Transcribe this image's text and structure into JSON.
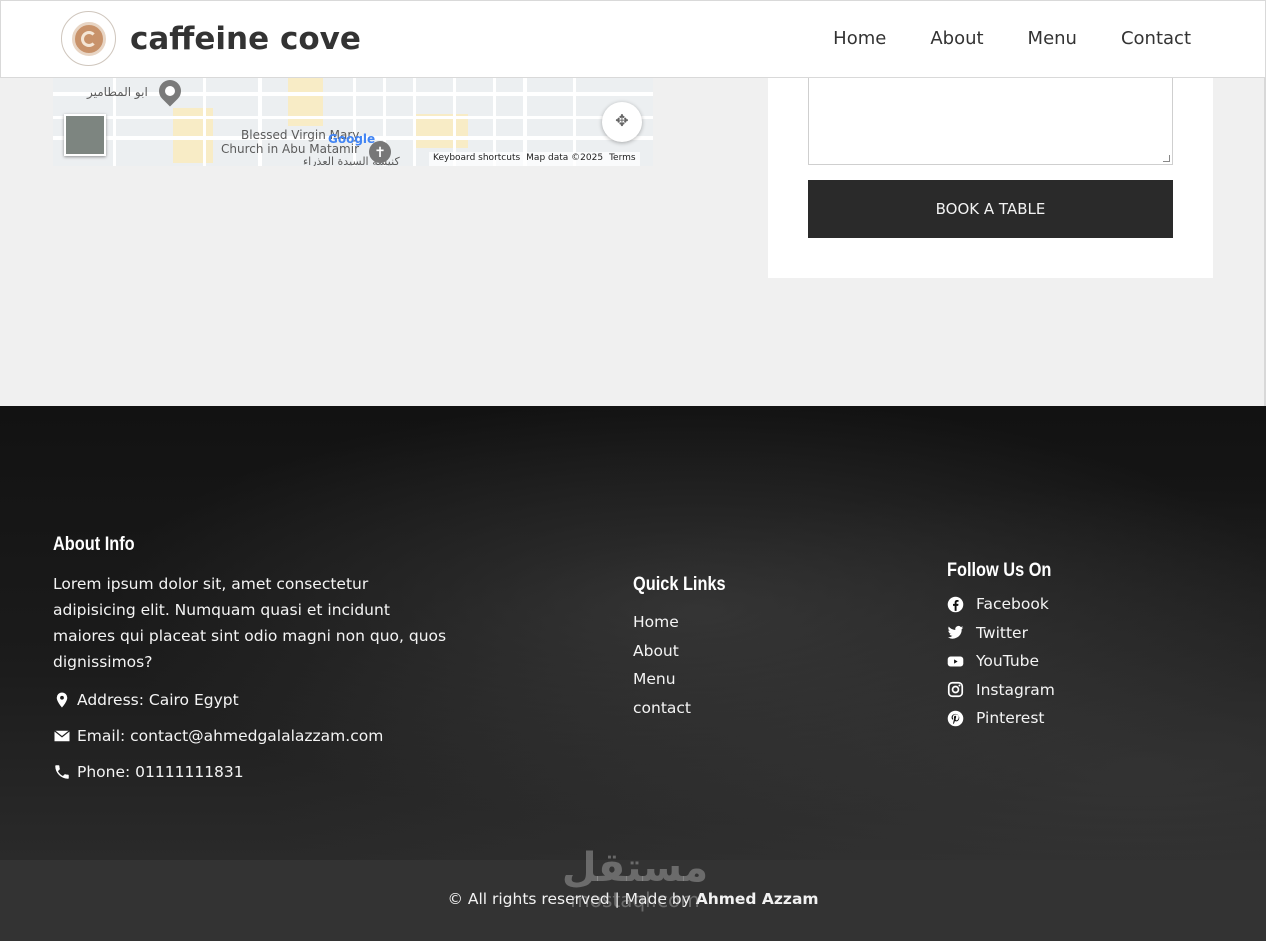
{
  "header": {
    "brand": "caffeine cove",
    "nav": [
      "Home",
      "About",
      "Menu",
      "Contact"
    ]
  },
  "map": {
    "label_arabic": "ابو المطامير",
    "label_church_line1": "Blessed Virgin Mary",
    "label_church_line2": "Church in Abu Matamir",
    "label_church_arabic": "كنيسة السيدة العذراء",
    "google": "Google",
    "attribution": [
      "Keyboard shortcuts",
      "Map data ©2025",
      "Terms"
    ]
  },
  "booking": {
    "button_label": "BOOK A TABLE"
  },
  "footer": {
    "about": {
      "heading": "About Info",
      "text": "Lorem ipsum dolor sit, amet consectetur adipisicing elit. Numquam quasi et incidunt maiores qui placeat sint odio magni non quo, quos dignissimos?",
      "address": "Address: Cairo Egypt",
      "email": "Email: contact@ahmedgalalazzam.com",
      "phone": "Phone: 01111111831"
    },
    "quick_links": {
      "heading": "Quick Links",
      "items": [
        "Home",
        "About",
        "Menu",
        "contact"
      ]
    },
    "follow": {
      "heading": "Follow Us On",
      "items": [
        {
          "label": "Facebook",
          "icon": "facebook-icon"
        },
        {
          "label": "Twitter",
          "icon": "twitter-icon"
        },
        {
          "label": "YouTube",
          "icon": "youtube-icon"
        },
        {
          "label": "Instagram",
          "icon": "instagram-icon"
        },
        {
          "label": "Pinterest",
          "icon": "pinterest-icon"
        }
      ]
    }
  },
  "bottom": {
    "prefix": "© All rights reserved | Made by ",
    "author": "Ahmed Azzam"
  },
  "watermark": {
    "arabic": "مستقل",
    "latin": "mostaql.com"
  },
  "colors": {
    "header_bg": "#ffffff",
    "page_bg": "#f0f0f0",
    "button_bg": "#2a2a2a",
    "bottom_bar": "#333333"
  }
}
